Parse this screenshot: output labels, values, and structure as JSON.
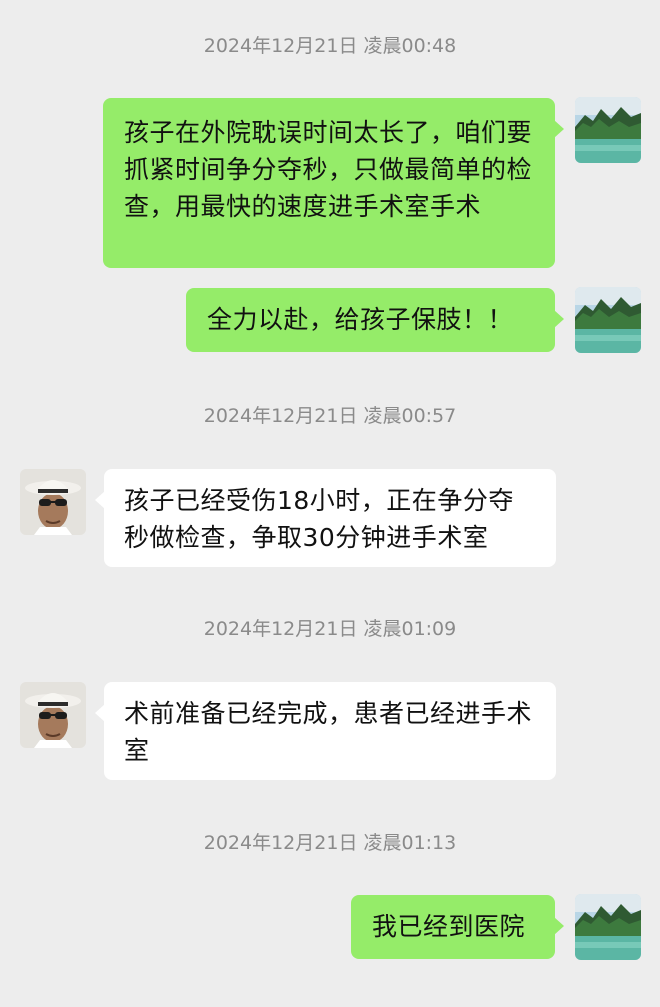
{
  "messages": [
    {
      "type": "timestamp",
      "text": "2024年12月21日 凌晨00:48"
    },
    {
      "type": "sent",
      "text": "孩子在外院耽误时间太长了，咱们要抓紧时间争分夺秒，只做最简单的检查，用最快的速度进手术室手术"
    },
    {
      "type": "sent",
      "text": "全力以赴，给孩子保肢！！"
    },
    {
      "type": "timestamp",
      "text": "2024年12月21日 凌晨00:57"
    },
    {
      "type": "received",
      "text": "孩子已经受伤18小时，正在争分夺秒做检查，争取30分钟进手术室"
    },
    {
      "type": "timestamp",
      "text": "2024年12月21日 凌晨01:09"
    },
    {
      "type": "received",
      "text": "术前准备已经完成，患者已经进手术室"
    },
    {
      "type": "timestamp",
      "text": "2024年12月21日 凌晨01:13"
    },
    {
      "type": "sent",
      "text": "我已经到医院"
    }
  ],
  "avatars": {
    "self": "landscape-lake-avatar",
    "other": "man-white-hat-sunglasses-avatar"
  },
  "colors": {
    "background": "#ededed",
    "sent_bubble": "#95ec69",
    "received_bubble": "#ffffff",
    "timestamp_text": "#8a8a8a"
  }
}
